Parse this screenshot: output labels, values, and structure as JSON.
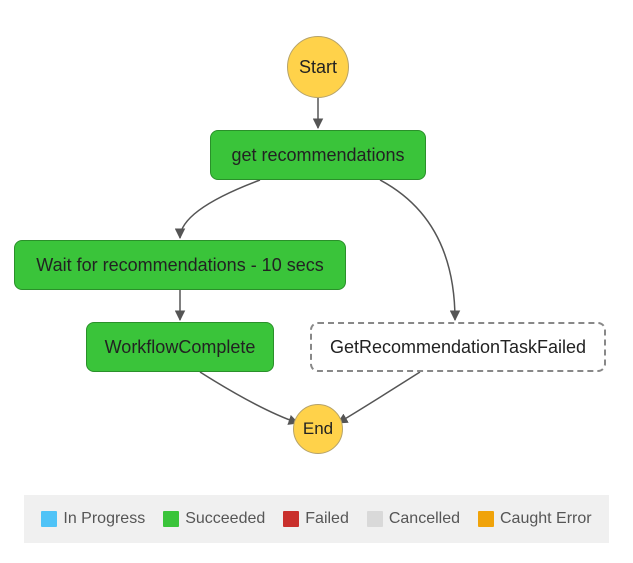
{
  "nodes": {
    "start": "Start",
    "get_recs": "get recommendations",
    "wait": "Wait for recommendations - 10 secs",
    "workflow_complete": "WorkflowComplete",
    "task_failed": "GetRecommendationTaskFailed",
    "end": "End"
  },
  "legend": {
    "in_progress": {
      "label": "In Progress",
      "color": "#4fc3f7"
    },
    "succeeded": {
      "label": "Succeeded",
      "color": "#3ac43a"
    },
    "failed": {
      "label": "Failed",
      "color": "#c9302c"
    },
    "cancelled": {
      "label": "Cancelled",
      "color": "#d9d9d9"
    },
    "caught": {
      "label": "Caught Error",
      "color": "#f0a30a"
    }
  }
}
